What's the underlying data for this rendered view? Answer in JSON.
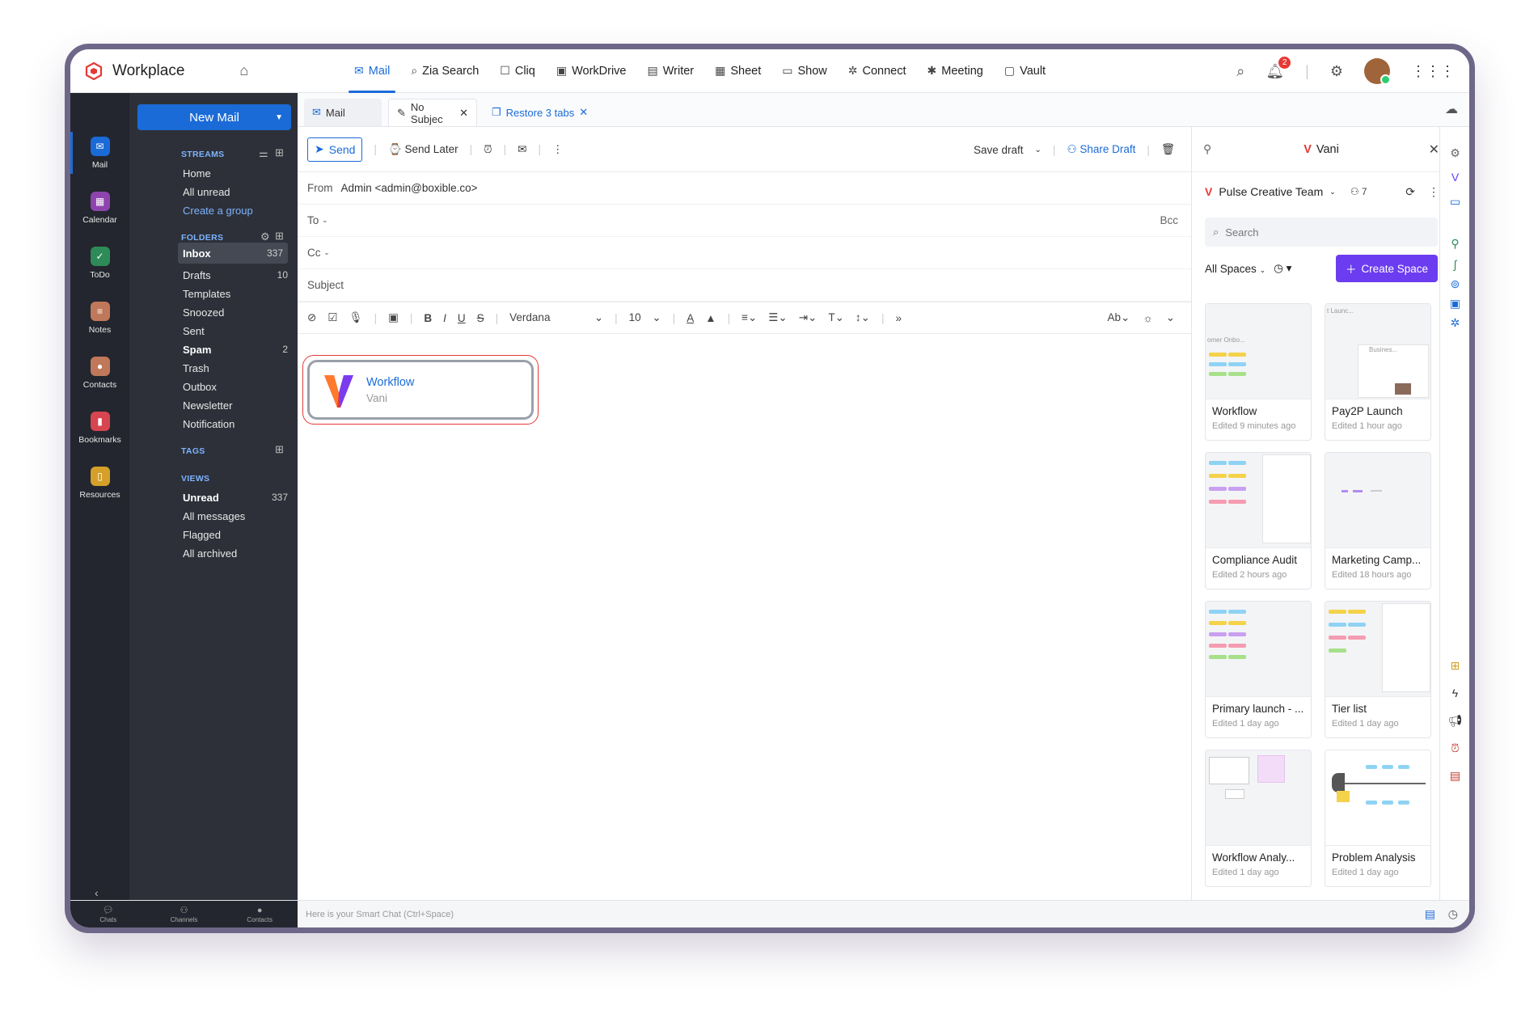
{
  "brand": {
    "title": "Workplace"
  },
  "apps": [
    {
      "label": "Mail",
      "icon": "mail-icon"
    },
    {
      "label": "Zia Search",
      "icon": "zia-search-icon"
    },
    {
      "label": "Cliq",
      "icon": "cliq-icon"
    },
    {
      "label": "WorkDrive",
      "icon": "workdrive-icon"
    },
    {
      "label": "Writer",
      "icon": "writer-icon"
    },
    {
      "label": "Sheet",
      "icon": "sheet-icon"
    },
    {
      "label": "Show",
      "icon": "show-icon"
    },
    {
      "label": "Connect",
      "icon": "connect-icon"
    },
    {
      "label": "Meeting",
      "icon": "meeting-icon"
    },
    {
      "label": "Vault",
      "icon": "vault-icon"
    }
  ],
  "topright": {
    "notification_count": "2"
  },
  "rail": [
    {
      "label": "Mail",
      "color": "#1a6bd8"
    },
    {
      "label": "Calendar",
      "color": "#8e44ad"
    },
    {
      "label": "ToDo",
      "color": "#2e8b57"
    },
    {
      "label": "Notes",
      "color": "#c0785a"
    },
    {
      "label": "Contacts",
      "color": "#c0785a"
    },
    {
      "label": "Bookmarks",
      "color": "#d64550"
    },
    {
      "label": "Resources",
      "color": "#d4a02a"
    }
  ],
  "folderpane": {
    "new_mail": "New Mail",
    "streams_heading": "STREAMS",
    "streams": [
      "Home",
      "All unread",
      "Create a group"
    ],
    "folders_heading": "FOLDERS",
    "folders": [
      {
        "label": "Inbox",
        "count": "337"
      },
      {
        "label": "Drafts",
        "count": "10"
      },
      {
        "label": "Templates",
        "count": ""
      },
      {
        "label": "Snoozed",
        "count": ""
      },
      {
        "label": "Sent",
        "count": ""
      },
      {
        "label": "Spam",
        "count": "2"
      },
      {
        "label": "Trash",
        "count": ""
      },
      {
        "label": "Outbox",
        "count": ""
      },
      {
        "label": "Newsletter",
        "count": ""
      },
      {
        "label": "Notification",
        "count": ""
      }
    ],
    "tags_heading": "TAGS",
    "views_heading": "VIEWS",
    "views": [
      {
        "label": "Unread",
        "count": "337"
      },
      {
        "label": "All messages",
        "count": ""
      },
      {
        "label": "Flagged",
        "count": ""
      },
      {
        "label": "All archived",
        "count": ""
      }
    ]
  },
  "bottombar": {
    "chats": "Chats",
    "channels": "Channels",
    "contacts": "Contacts",
    "smartchat": "Here is your Smart Chat (Ctrl+Space)"
  },
  "tabs": {
    "mail": "Mail",
    "current": "No Subjec",
    "restore": "Restore 3 tabs"
  },
  "compose": {
    "send": "Send",
    "send_later": "Send Later",
    "save_draft": "Save draft",
    "share_draft": "Share Draft",
    "from_label": "From",
    "from_value": "Admin <admin@boxible.co>",
    "to_label": "To",
    "bcc_label": "Bcc",
    "cc_label": "Cc",
    "subject_label": "Subject",
    "font": "Verdana",
    "size": "10",
    "card_title": "Workflow",
    "card_subtitle": "Vani"
  },
  "vani": {
    "title": "Vani",
    "team": "Pulse Creative Team",
    "members": "7",
    "search_placeholder": "Search",
    "spaces_filter": "All Spaces",
    "create_space": "Create Space",
    "spaces": [
      {
        "name": "Workflow",
        "edited": "Edited 9 minutes ago",
        "thumb_text": "omer Onbo..."
      },
      {
        "name": "Pay2P Launch",
        "edited": "Edited 1 hour ago",
        "thumb_text": "t Launc..."
      },
      {
        "name": "Compliance Audit",
        "edited": "Edited 2 hours ago",
        "thumb_text": ""
      },
      {
        "name": "Marketing Camp...",
        "edited": "Edited 18 hours ago",
        "thumb_text": ""
      },
      {
        "name": "Primary launch - ...",
        "edited": "Edited 1 day ago",
        "thumb_text": ""
      },
      {
        "name": "Tier list",
        "edited": "Edited 1 day ago",
        "thumb_text": ""
      },
      {
        "name": "Workflow Analy...",
        "edited": "Edited 1 day ago",
        "thumb_text": ""
      },
      {
        "name": "Problem Analysis",
        "edited": "Edited 1 day ago",
        "thumb_text": ""
      }
    ],
    "pay2p_extra": "Busines..."
  }
}
